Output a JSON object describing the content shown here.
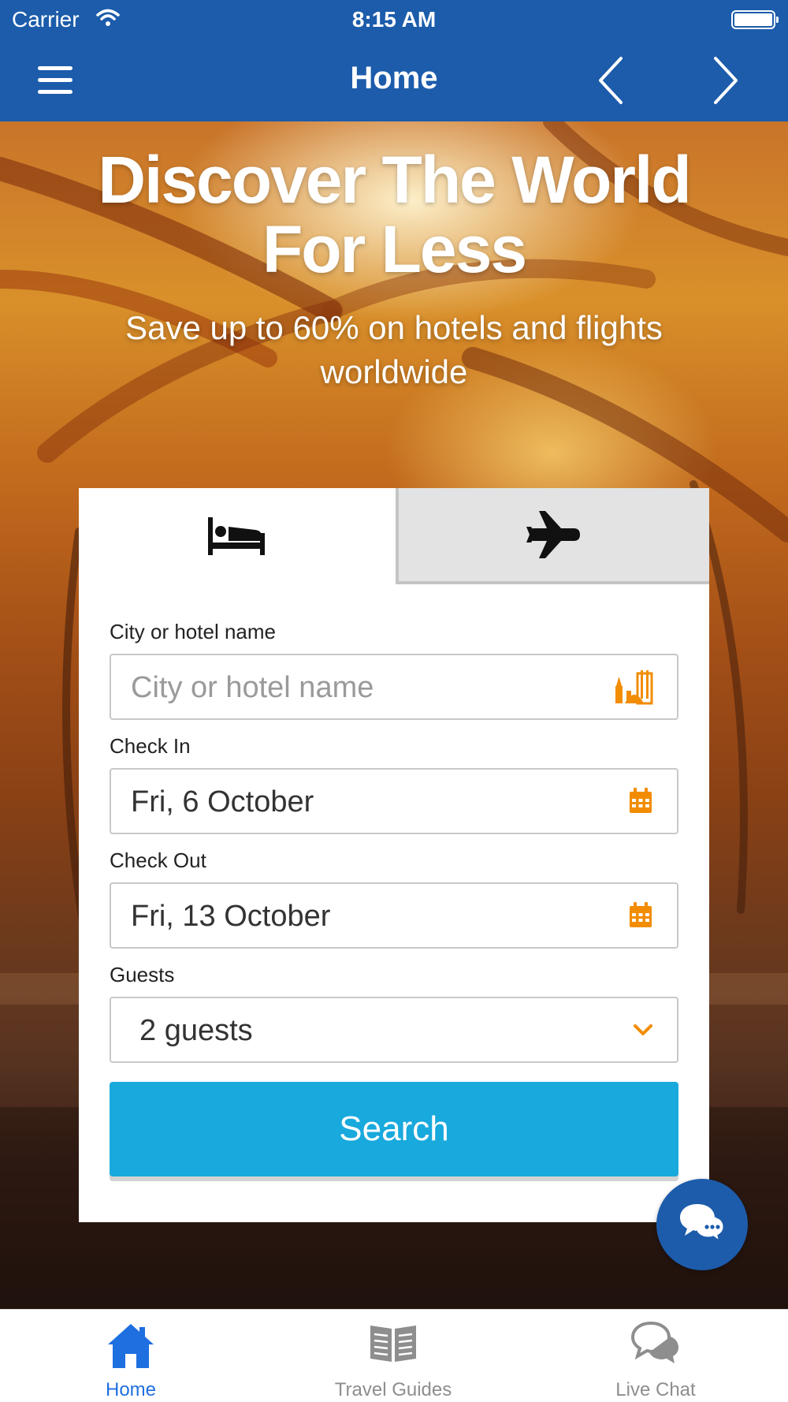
{
  "status_bar": {
    "carrier": "Carrier",
    "time": "8:15 AM",
    "wifi_icon": "wifi-icon",
    "battery_icon": "battery-icon"
  },
  "nav_bar": {
    "title": "Home",
    "menu_icon": "hamburger-menu-icon",
    "back_icon": "chevron-left-icon",
    "forward_icon": "chevron-right-icon"
  },
  "hero": {
    "title": "Discover The World For Less",
    "subtitle": "Save up to 60% on hotels and flights worldwide"
  },
  "search_card": {
    "tabs": [
      {
        "name": "hotels",
        "icon": "bed-icon",
        "selected": true
      },
      {
        "name": "flights",
        "icon": "airplane-icon",
        "selected": false
      }
    ],
    "destination": {
      "label": "City or hotel name",
      "placeholder": "City or hotel name",
      "value": "",
      "icon": "city-landmarks-icon"
    },
    "check_in": {
      "label": "Check In",
      "value": "Fri, 6 October",
      "icon": "calendar-icon"
    },
    "check_out": {
      "label": "Check Out",
      "value": "Fri, 13 October",
      "icon": "calendar-icon"
    },
    "guests": {
      "label": "Guests",
      "value": "2 guests",
      "icon": "chevron-down-icon"
    },
    "search_label": "Search"
  },
  "chat_fab": {
    "icon": "chat-bubbles-icon"
  },
  "tab_bar": {
    "items": [
      {
        "label": "Home",
        "icon": "home-icon",
        "active": true
      },
      {
        "label": "Travel Guides",
        "icon": "book-icon",
        "active": false
      },
      {
        "label": "Live Chat",
        "icon": "chat-bubbles-icon",
        "active": false
      }
    ]
  },
  "colors": {
    "brand_blue": "#1c5cab",
    "search_button": "#18a9dd",
    "accent_orange": "#f28c00",
    "active_tab": "#1e6fe0"
  }
}
